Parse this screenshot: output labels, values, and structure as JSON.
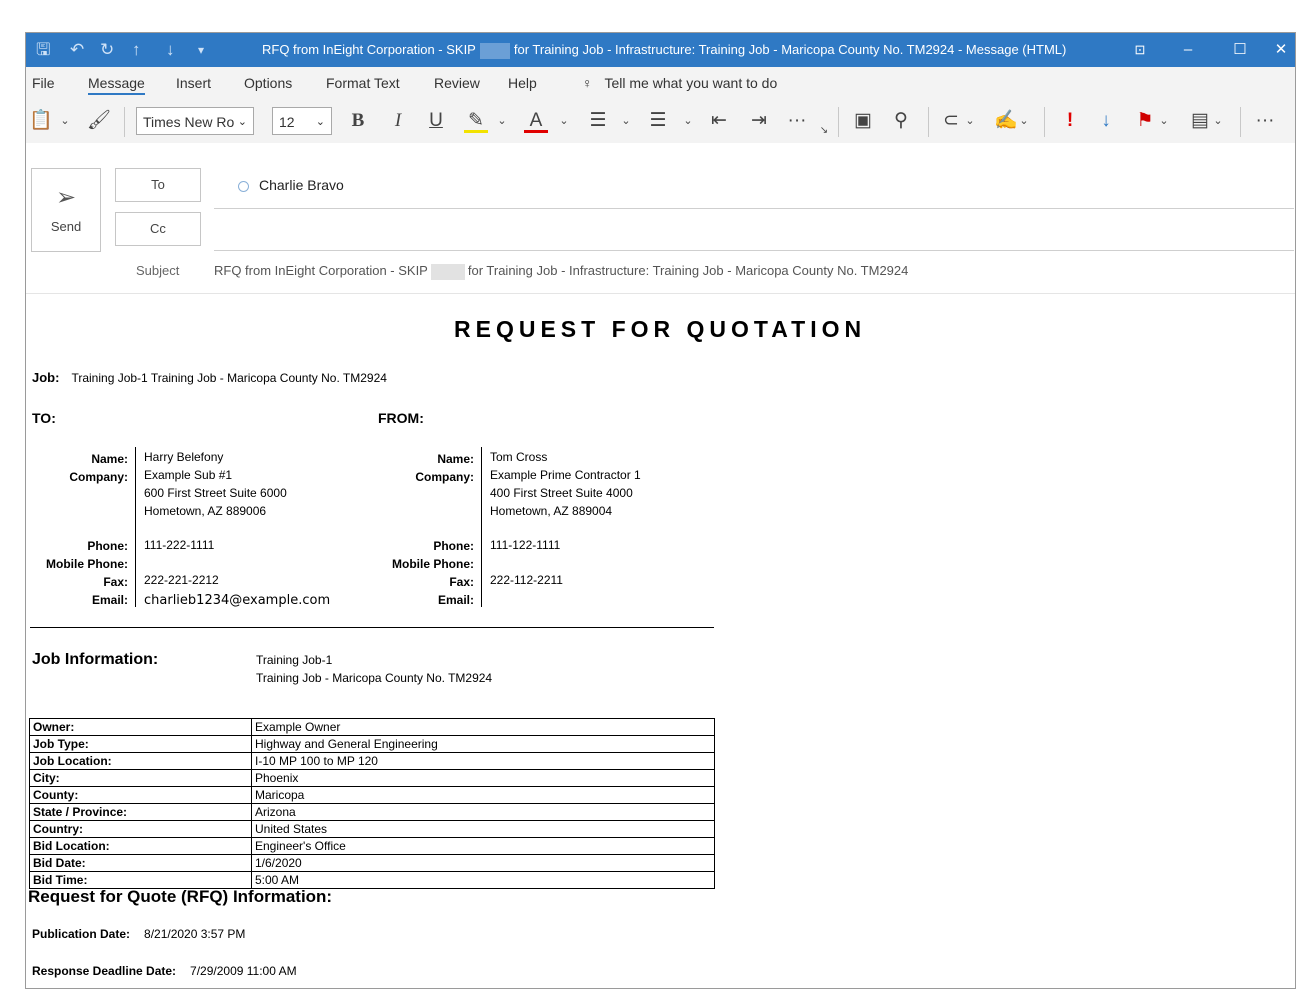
{
  "titlebar": {
    "title_part1": "RFQ from InEight Corporation - SKIP",
    "title_part2": "for Training Job - Infrastructure: Training Job - Maricopa County No. TM2924  -  Message (HTML)"
  },
  "menu": {
    "items": [
      "File",
      "Message",
      "Insert",
      "Options",
      "Format Text",
      "Review",
      "Help"
    ],
    "active": "Message",
    "tell_me": "Tell me what you want to do"
  },
  "ribbon": {
    "font_name": "Times New Ro",
    "font_size": "12"
  },
  "compose": {
    "send_label": "Send",
    "to_label": "To",
    "cc_label": "Cc",
    "to_recipient": "Charlie Bravo",
    "subject_label": "Subject",
    "subject_part1": "RFQ from InEight Corporation - SKIP",
    "subject_part2": "for Training Job - Infrastructure: Training Job - Maricopa County No. TM2924"
  },
  "doc": {
    "title": "REQUEST FOR QUOTATION",
    "job_label": "Job:",
    "job_value": "Training Job-1 Training Job - Maricopa County No. TM2924",
    "to_header": "TO:",
    "from_header": "FROM:",
    "labels": {
      "name": "Name:",
      "company": "Company:",
      "phone": "Phone:",
      "mobile": "Mobile Phone:",
      "fax": "Fax:",
      "email": "Email:"
    },
    "to": {
      "name": "Harry Belefony",
      "company": "Example Sub #1",
      "address1": "600 First Street Suite 6000",
      "address2": "Hometown, AZ 889006",
      "phone": "111-222-1111",
      "mobile": "",
      "fax": "222-221-2212",
      "email": "charlieb1234@example.com"
    },
    "from": {
      "name": "Tom Cross",
      "company": "Example Prime Contractor 1",
      "address1": "400 First Street Suite 4000",
      "address2": "Hometown, AZ 889004",
      "phone": "111-122-1111",
      "mobile": "",
      "fax": "222-112-2211",
      "email": ""
    },
    "job_info_title": "Job Information:",
    "job_info_line1": "Training Job-1",
    "job_info_line2": "Training Job - Maricopa County No. TM2924",
    "job_table": [
      {
        "k": "Owner:",
        "v": "Example Owner"
      },
      {
        "k": "Job Type:",
        "v": "Highway and General Engineering"
      },
      {
        "k": "Job Location:",
        "v": "I-10 MP 100 to MP 120"
      },
      {
        "k": "City:",
        "v": "Phoenix"
      },
      {
        "k": "County:",
        "v": "Maricopa"
      },
      {
        "k": "State / Province:",
        "v": "Arizona"
      },
      {
        "k": "Country:",
        "v": "United States"
      },
      {
        "k": "Bid Location:",
        "v": "Engineer's Office"
      },
      {
        "k": "Bid Date:",
        "v": "1/6/2020"
      },
      {
        "k": "Bid Time:",
        "v": "5:00 AM"
      }
    ],
    "rfq_title": "Request for Quote (RFQ) Information:",
    "pub_label": "Publication Date:",
    "pub_value": "8/21/2020 3:57 PM",
    "deadline_label": "Response Deadline Date:",
    "deadline_value": "7/29/2009 11:00 AM"
  }
}
